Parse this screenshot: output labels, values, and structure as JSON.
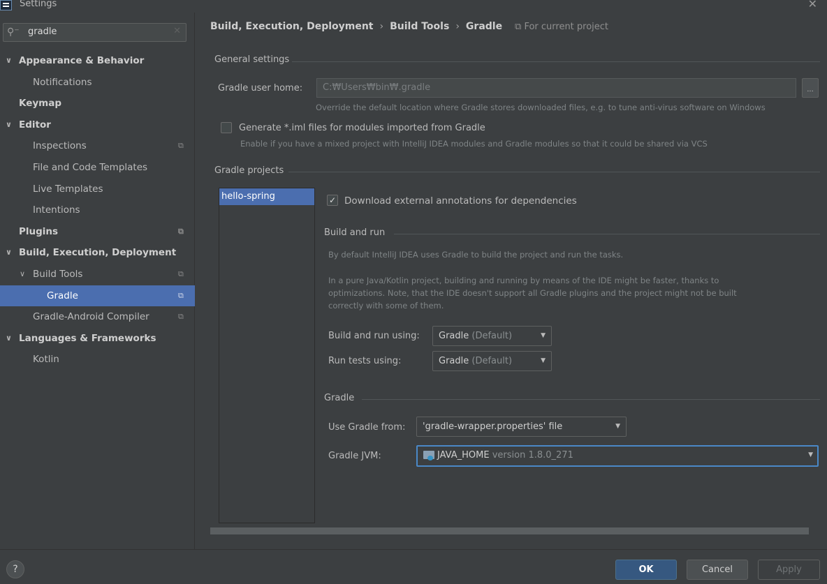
{
  "window": {
    "title": "Settings",
    "close_glyph": "✕"
  },
  "search": {
    "value": "gradle",
    "icon": "search-icon",
    "clear_glyph": "✕"
  },
  "tree": [
    {
      "label": "Appearance & Behavior",
      "level": 0,
      "bold": true,
      "expanded": true
    },
    {
      "label": "Notifications",
      "level": 1
    },
    {
      "label": "Keymap",
      "level": 0,
      "bold": true
    },
    {
      "label": "Editor",
      "level": 0,
      "bold": true,
      "expanded": true
    },
    {
      "label": "Inspections",
      "level": 1,
      "copy_icon": true
    },
    {
      "label": "File and Code Templates",
      "level": 1
    },
    {
      "label": "Live Templates",
      "level": 1
    },
    {
      "label": "Intentions",
      "level": 1
    },
    {
      "label": "Plugins",
      "level": 0,
      "bold": true,
      "copy_icon": true
    },
    {
      "label": "Build, Execution, Deployment",
      "level": 0,
      "bold": true,
      "expanded": true
    },
    {
      "label": "Build Tools",
      "level": 1,
      "expanded": true,
      "copy_icon": true
    },
    {
      "label": "Gradle",
      "level": 2,
      "selected": true,
      "copy_icon": true
    },
    {
      "label": "Gradle-Android Compiler",
      "level": 1,
      "copy_icon": true
    },
    {
      "label": "Languages & Frameworks",
      "level": 0,
      "bold": true,
      "expanded": true
    },
    {
      "label": "Kotlin",
      "level": 1
    }
  ],
  "breadcrumb": {
    "items": [
      "Build, Execution, Deployment",
      "Build Tools",
      "Gradle"
    ],
    "separator": "›",
    "scope": "For current project"
  },
  "general": {
    "title": "General settings",
    "user_home_label": "Gradle user home:",
    "user_home_value": "C:₩Users₩bin₩.gradle",
    "browse_label": "...",
    "user_home_hint": "Override the default location where Gradle stores downloaded files, e.g. to tune anti-virus software on Windows",
    "iml_label": "Generate *.iml files for modules imported from Gradle",
    "iml_checked": false,
    "iml_hint": "Enable if you have a mixed project with IntelliJ IDEA modules and Gradle modules so that it could be shared via VCS"
  },
  "projects": {
    "title": "Gradle projects",
    "items": [
      "hello-spring"
    ],
    "download_annotations_label": "Download external annotations for dependencies",
    "download_annotations_checked": true
  },
  "build_run": {
    "title": "Build and run",
    "desc1": "By default IntelliJ IDEA uses Gradle to build the project and run the tasks.",
    "desc2_lines": [
      "In a pure Java/Kotlin project, building and running by means of the IDE might be faster, thanks to",
      "optimizations. Note, that the IDE doesn't support all Gradle plugins and the project might not be built",
      "correctly with some of them."
    ],
    "build_using_label": "Build and run using:",
    "build_using_value": "Gradle",
    "build_using_suffix": "(Default)",
    "tests_using_label": "Run tests using:",
    "tests_using_value": "Gradle",
    "tests_using_suffix": "(Default)"
  },
  "gradle": {
    "title": "Gradle",
    "use_from_label": "Use Gradle from:",
    "use_from_value": "'gradle-wrapper.properties' file",
    "jvm_label": "Gradle JVM:",
    "jvm_value": "JAVA_HOME",
    "jvm_version": "version 1.8.0_271"
  },
  "footer": {
    "help_label": "?",
    "ok_label": "OK",
    "cancel_label": "Cancel",
    "apply_label": "Apply"
  },
  "colors": {
    "background": "#3c3f41",
    "selection": "#4b6eaf",
    "focus_border": "#4a88c7",
    "ok_button": "#365880"
  }
}
